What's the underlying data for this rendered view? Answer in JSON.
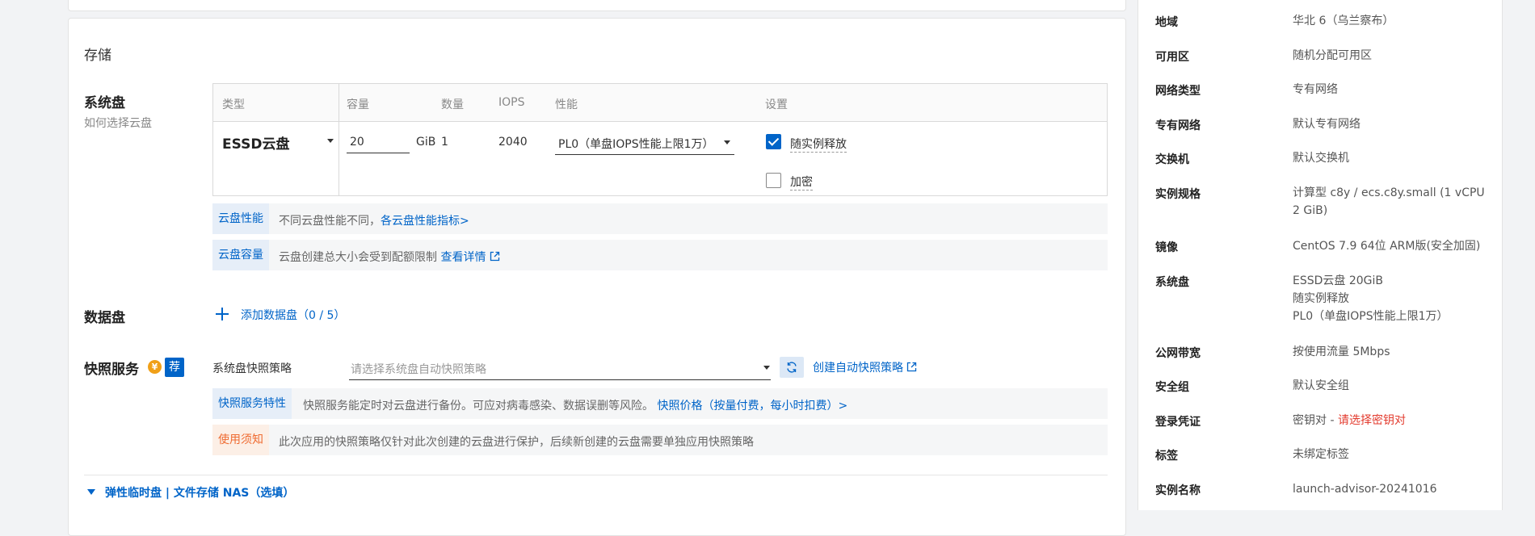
{
  "storage": {
    "section_title": "存储",
    "system_disk": {
      "label": "系统盘",
      "help_link": "如何选择云盘",
      "columns": [
        "类型",
        "容量",
        "数量",
        "IOPS",
        "性能",
        "设置"
      ],
      "type_value": "ESSD云盘",
      "capacity_value": "20",
      "capacity_unit": "GiB",
      "quantity": "1",
      "iops": "2040",
      "performance": "PL0（单盘IOPS性能上限1万）",
      "release_with_instance": {
        "label": "随实例释放",
        "checked": true
      },
      "encrypt": {
        "label": "加密",
        "checked": false
      }
    },
    "perf_info": {
      "tag": "云盘性能",
      "text": "不同云盘性能不同，",
      "link": "各云盘性能指标>"
    },
    "capacity_info": {
      "tag": "云盘容量",
      "text": "云盘创建总大小会受到配额限制",
      "link": "查看详情"
    },
    "data_disk": {
      "label": "数据盘",
      "add_label": "添加数据盘（0 / 5）"
    },
    "snapshot": {
      "label": "快照服务",
      "badge": "荐",
      "yen": "¥",
      "policy_label": "系统盘快照策略",
      "policy_placeholder": "请选择系统盘自动快照策略",
      "create_link": "创建自动快照策略",
      "feature_tag": "快照服务特性",
      "feature_text": "快照服务能定时对云盘进行备份。可应对病毒感染、数据误删等风险。",
      "price_link": "快照价格（按量付费，每小时扣费）>",
      "notice_tag": "使用须知",
      "notice_text": "此次应用的快照策略仅针对此次创建的云盘进行保护，后续新创建的云盘需要单独应用快照策略"
    },
    "extra_toggle": "弹性临时盘 | 文件存储 NAS（选填）"
  },
  "summary": {
    "region": {
      "key": "地域",
      "value": "华北 6（乌兰察布）"
    },
    "zone": {
      "key": "可用区",
      "value": "随机分配可用区"
    },
    "network_type": {
      "key": "网络类型",
      "value": "专有网络"
    },
    "vpc": {
      "key": "专有网络",
      "value": "默认专有网络"
    },
    "vswitch": {
      "key": "交换机",
      "value": "默认交换机"
    },
    "instance_type": {
      "key": "实例规格",
      "value": "计算型 c8y / ecs.c8y.small (1 vCPU 2 GiB)"
    },
    "image": {
      "key": "镜像",
      "value": "CentOS 7.9 64位 ARM版(安全加固)"
    },
    "system_disk": {
      "key": "系统盘",
      "line1": "ESSD云盘 20GiB",
      "line2": "随实例释放",
      "line3": "PL0（单盘IOPS性能上限1万）"
    },
    "bandwidth": {
      "key": "公网带宽",
      "value": "按使用流量 5Mbps"
    },
    "security_group": {
      "key": "安全组",
      "value": "默认安全组"
    },
    "login": {
      "key": "登录凭证",
      "prefix": "密钥对 - ",
      "warning": "请选择密钥对"
    },
    "tags": {
      "key": "标签",
      "value": "未绑定标签"
    },
    "instance_name": {
      "key": "实例名称",
      "value": "launch-advisor-20241016"
    }
  },
  "colors": {
    "accent": "#0064c8",
    "warning": "#ef6b31",
    "error": "#e33b2e"
  }
}
